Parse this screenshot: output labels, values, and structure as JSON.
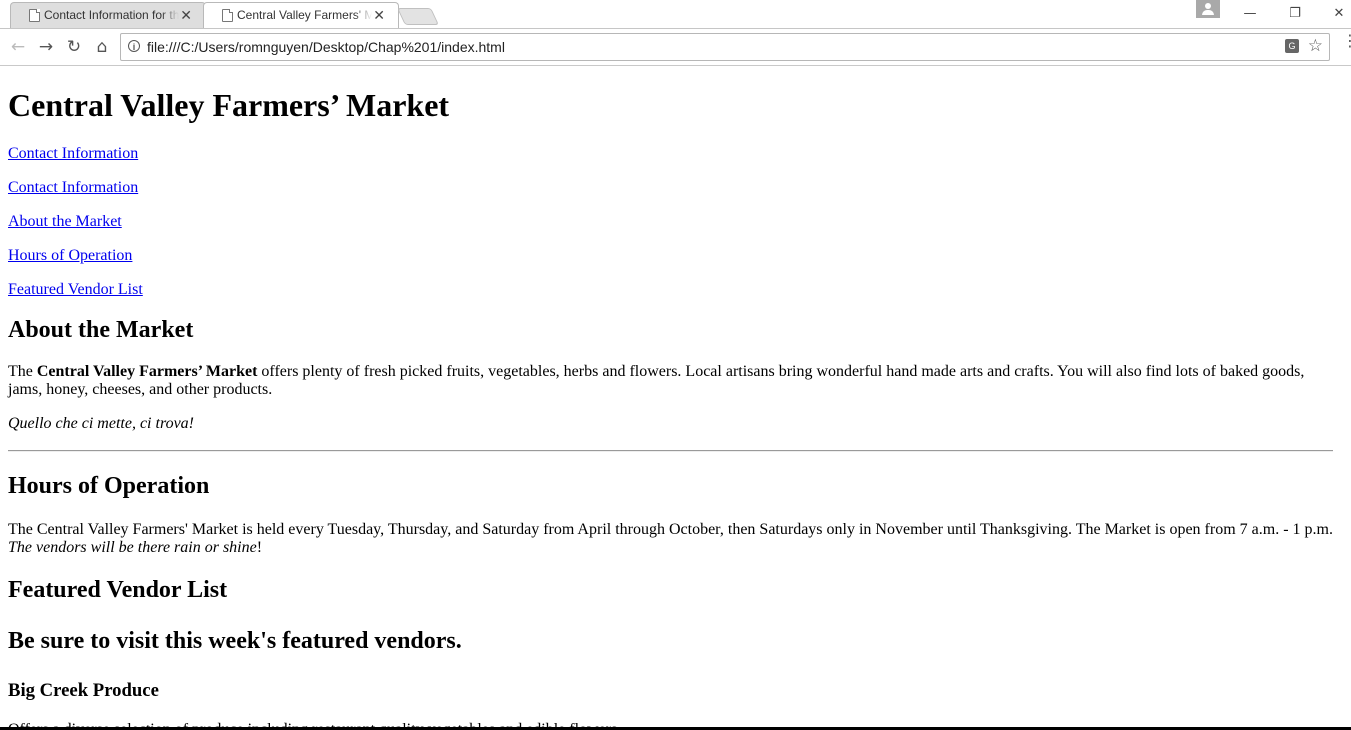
{
  "browser": {
    "tabs": [
      {
        "title": "Contact Information for the"
      },
      {
        "title": "Central Valley Farmers' Market"
      }
    ],
    "address": "file:///C:/Users/romnguyen/Desktop/Chap%201/index.html",
    "controls": {
      "back": "←",
      "forward": "→",
      "reload": "↻",
      "home": "⌂",
      "star": "☆",
      "minimize": "—",
      "restore": "❐",
      "close": "✕",
      "tab_close": "✕",
      "menu": "⋮"
    }
  },
  "page": {
    "title": "Central Valley Farmers’ Market",
    "nav_links": [
      "Contact Information",
      "Contact Information",
      "About the Market",
      "Hours of Operation",
      "Featured Vendor List"
    ],
    "about": {
      "heading": "About the Market",
      "p1_prefix": "The ",
      "p1_bold": "Central Valley Farmers’ Market",
      "p1_rest": " offers plenty of fresh picked fruits, vegetables, herbs and flowers. Local artisans bring wonderful hand made arts and crafts. You will also find lots of baked goods, jams, honey, cheeses, and other products.",
      "motto": "Quello che ci mette, ci trova!"
    },
    "hours": {
      "heading": "Hours of Operation",
      "text": "The Central Valley Farmers' Market is held every Tuesday, Thursday, and Saturday from April through October, then Saturdays only in November until Thanksgiving. The Market is open from 7 a.m. - 1 p.m.",
      "italic": "The vendors will be there rain or shine",
      "after_italic": "!"
    },
    "vendors": {
      "heading": "Featured Vendor List",
      "subheading": "Be sure to visit this week's featured vendors.",
      "vendor1_name": "Big Creek Produce",
      "vendor1_desc": "Offers a diverse selection of produce including restaurant quality vegetables and edible flowers."
    }
  }
}
